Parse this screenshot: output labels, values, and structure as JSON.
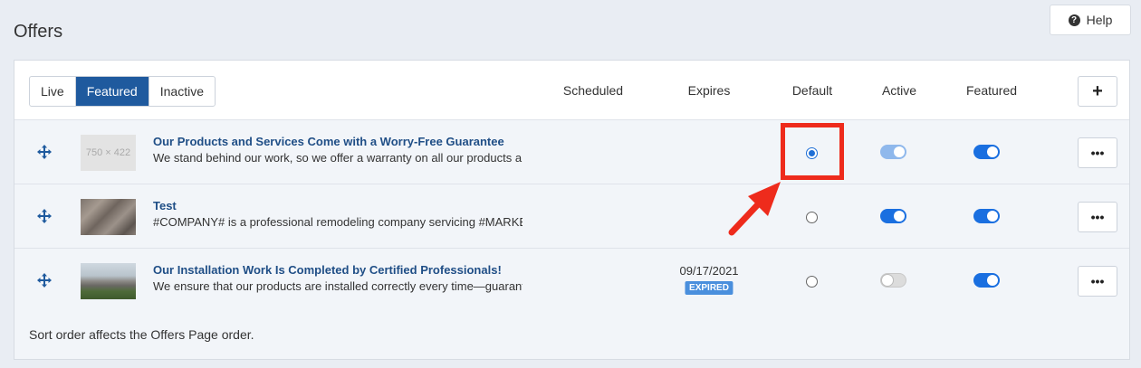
{
  "page": {
    "title": "Offers"
  },
  "help": {
    "label": "Help",
    "icon": "question-circle-icon"
  },
  "tabs": [
    {
      "label": "Live",
      "active": false
    },
    {
      "label": "Featured",
      "active": true
    },
    {
      "label": "Inactive",
      "active": false
    }
  ],
  "columns": {
    "scheduled": "Scheduled",
    "expires": "Expires",
    "default": "Default",
    "active": "Active",
    "featured": "Featured"
  },
  "add_button": {
    "label": "+"
  },
  "offers": [
    {
      "thumbnail_label": "750 × 422",
      "title": "Our Products and Services Come with a Worry-Free Guarantee",
      "description": "We stand behind our work, so we offer a warranty on all our products and services.",
      "expires": "",
      "status_badge": "",
      "default": true,
      "active": "on-light",
      "featured": true,
      "more_label": "•••"
    },
    {
      "thumbnail_label": "",
      "title": "Test",
      "description": "#COMPANY# is a professional remodeling company servicing #MARKET#.",
      "expires": "",
      "status_badge": "",
      "default": false,
      "active": "on",
      "featured": true,
      "more_label": "•••"
    },
    {
      "thumbnail_label": "",
      "title": "Our Installation Work Is Completed by Certified Professionals!",
      "description": "We ensure that our products are installed correctly every time—guaranteed.",
      "expires": "09/17/2021",
      "status_badge": "EXPIRED",
      "default": false,
      "active": "off",
      "featured": true,
      "more_label": "•••"
    }
  ],
  "footnote": "Sort order affects the Offers Page order.",
  "colors": {
    "primary": "#1f5a9e",
    "toggle_on": "#1a6fe0",
    "highlight": "#ee2b1c",
    "background": "#e9edf3"
  }
}
